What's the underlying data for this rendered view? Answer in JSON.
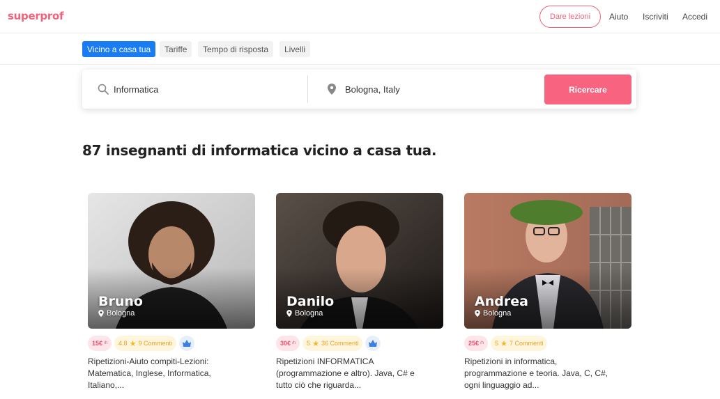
{
  "header": {
    "logo": "superprof",
    "give_lessons": "Dare lezioni",
    "help": "Aiuto",
    "signup": "Iscriviti",
    "login": "Accedi"
  },
  "filters": [
    "Vicino a casa tua",
    "Tariffe",
    "Tempo di risposta",
    "Livelli"
  ],
  "search": {
    "subject": "Informatica",
    "location": "Bologna, Italy",
    "button": "Ricercare"
  },
  "results_heading": "87 insegnanti di informatica vicino a casa tua.",
  "tutors": [
    {
      "name": "Bruno",
      "city": "Bologna",
      "price": "15€",
      "unit": "/h",
      "rating": "4.8",
      "comments": "9 Commenti",
      "description": "Ripetizioni-Aiuto compiti-Lezioni: Matematica, Inglese, Informatica, Italiano,..."
    },
    {
      "name": "Danilo",
      "city": "Bologna",
      "price": "30€",
      "unit": "/h",
      "rating": "5",
      "comments": "36 Commenti",
      "description": "Ripetizioni INFORMATICA (programmazione e altro). Java, C# e tutto ciò che riguarda..."
    },
    {
      "name": "Andrea",
      "city": "Bologna",
      "price": "25€",
      "unit": "/h",
      "rating": "5",
      "comments": "7 Commenti",
      "description": "Ripetizioni in informatica, programmazione e teoria. Java, C, C#, ogni linguaggio ad..."
    }
  ],
  "colors": {
    "brand": "#f0637b",
    "search_button": "#f8637f",
    "active_filter": "#1a7cf2",
    "price_bg": "#fde5ea",
    "rating_bg": "#fff5dc"
  }
}
